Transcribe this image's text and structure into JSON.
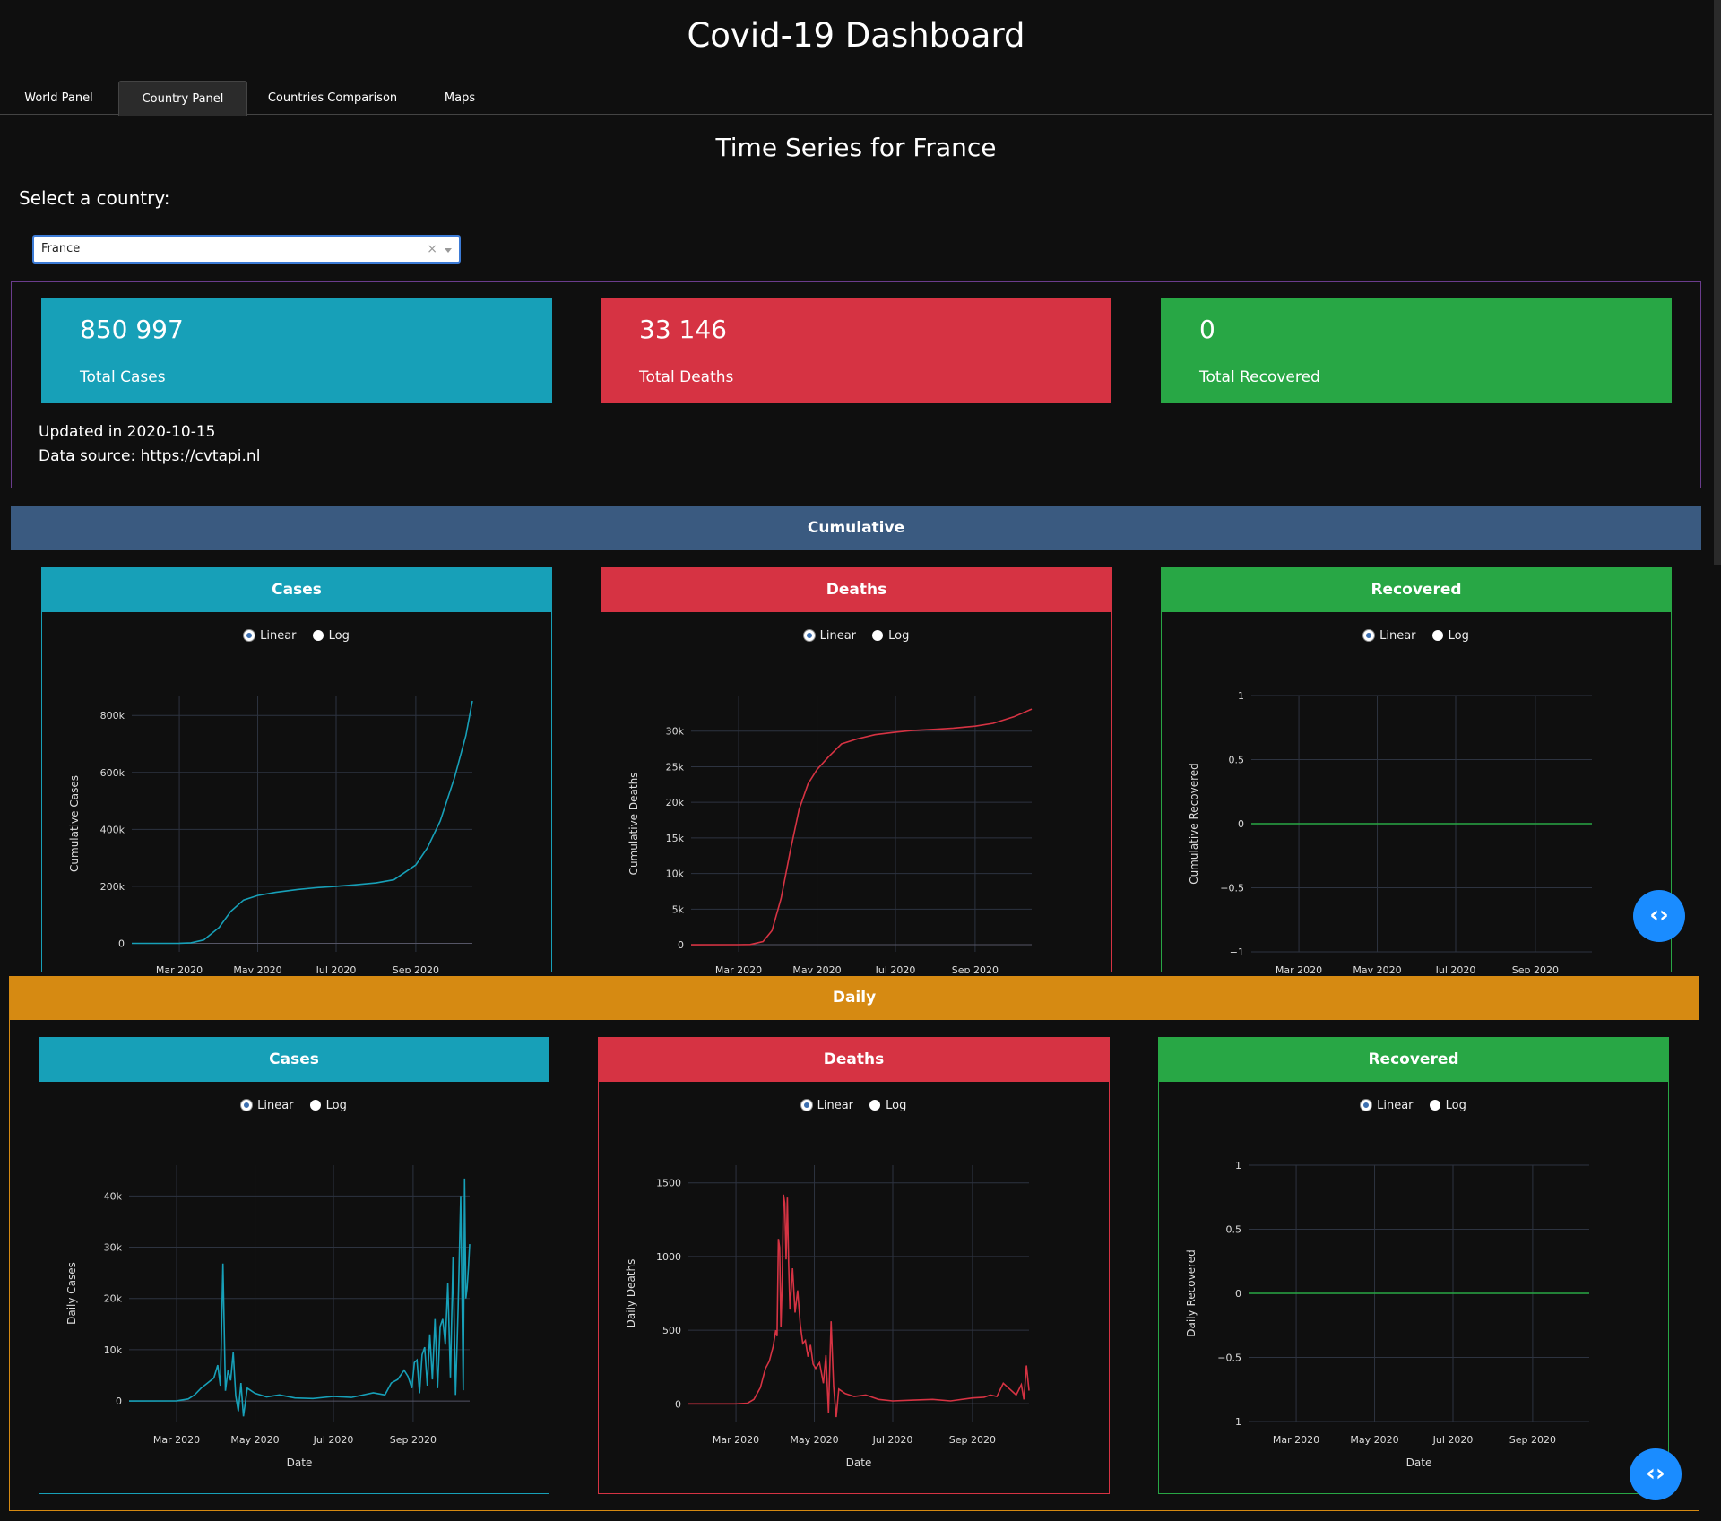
{
  "app": {
    "title": "Covid-19 Dashboard"
  },
  "tabs": [
    {
      "label": "World Panel"
    },
    {
      "label": "Country Panel",
      "active": true
    },
    {
      "label": "Countries Comparison"
    },
    {
      "label": "Maps"
    }
  ],
  "page": {
    "heading": "Time Series for France"
  },
  "selector": {
    "label": "Select a country:",
    "value": "France",
    "clear": "×"
  },
  "summary": {
    "cases": {
      "value": "850 997",
      "label": "Total Cases",
      "color": "#17a0b8"
    },
    "deaths": {
      "value": "33 146",
      "label": "Total Deaths",
      "color": "#d63343"
    },
    "recovered": {
      "value": "0",
      "label": "Total Recovered",
      "color": "#28a745"
    },
    "updated": "Updated in 2020-10-15",
    "source": "Data source: https://cvtapi.nl"
  },
  "sections": {
    "cumulative": "Cumulative",
    "daily": "Daily"
  },
  "panels": {
    "cases": "Cases",
    "deaths": "Deaths",
    "recovered": "Recovered",
    "linear": "Linear",
    "log": "Log"
  },
  "fab": {
    "icon": "code-brackets-icon"
  },
  "chart_data": [
    {
      "type": "line",
      "id": "cum-cases",
      "color": "#17a0b8",
      "ylabel": "Cumulative Cases",
      "xlabel": "",
      "xticks": [
        "Mar 2020",
        "May 2020",
        "Jul 2020",
        "Sep 2020"
      ],
      "yticks": [
        "0",
        "200k",
        "400k",
        "600k",
        "800k"
      ],
      "ylim": [
        -30000,
        870000
      ],
      "x": [
        "2020-01-24",
        "2020-03-01",
        "2020-03-10",
        "2020-03-20",
        "2020-04-01",
        "2020-04-10",
        "2020-04-20",
        "2020-05-01",
        "2020-05-15",
        "2020-06-01",
        "2020-06-15",
        "2020-07-01",
        "2020-07-15",
        "2020-08-01",
        "2020-08-15",
        "2020-09-01",
        "2020-09-10",
        "2020-09-20",
        "2020-10-01",
        "2020-10-10",
        "2020-10-15"
      ],
      "values": [
        0,
        130,
        1800,
        12000,
        56000,
        112000,
        152000,
        168000,
        179000,
        189000,
        195000,
        200000,
        205000,
        212000,
        223000,
        275000,
        335000,
        430000,
        580000,
        730000,
        851000
      ]
    },
    {
      "type": "line",
      "id": "cum-deaths",
      "color": "#d63343",
      "ylabel": "Cumulative Deaths",
      "xlabel": "",
      "xticks": [
        "Mar 2020",
        "May 2020",
        "Jul 2020",
        "Sep 2020"
      ],
      "yticks": [
        "0",
        "5k",
        "10k",
        "15k",
        "20k",
        "25k",
        "30k"
      ],
      "ylim": [
        -1000,
        35000
      ],
      "x": [
        "2020-01-24",
        "2020-03-01",
        "2020-03-10",
        "2020-03-20",
        "2020-03-27",
        "2020-04-03",
        "2020-04-10",
        "2020-04-17",
        "2020-04-24",
        "2020-05-01",
        "2020-05-10",
        "2020-05-20",
        "2020-06-01",
        "2020-06-15",
        "2020-07-01",
        "2020-07-15",
        "2020-08-01",
        "2020-08-15",
        "2020-09-01",
        "2020-09-15",
        "2020-10-01",
        "2020-10-15"
      ],
      "values": [
        0,
        2,
        33,
        450,
        2000,
        6500,
        13000,
        19000,
        22600,
        24600,
        26400,
        28200,
        28900,
        29500,
        29850,
        30100,
        30250,
        30420,
        30700,
        31100,
        32000,
        33100
      ]
    },
    {
      "type": "line",
      "id": "cum-recovered",
      "color": "#28a745",
      "ylabel": "Cumulative Recovered",
      "xlabel": "",
      "xticks": [
        "Mar 2020",
        "May 2020",
        "Jul 2020",
        "Sep 2020"
      ],
      "yticks": [
        "−1",
        "−0.5",
        "0",
        "0.5",
        "1"
      ],
      "ylim": [
        -1,
        1
      ],
      "x": [
        "2020-01-24",
        "2020-10-15"
      ],
      "values": [
        0,
        0
      ]
    },
    {
      "type": "line",
      "id": "daily-cases",
      "color": "#17a0b8",
      "ylabel": "Daily Cases",
      "xlabel": "Date",
      "xticks": [
        "Mar 2020",
        "May 2020",
        "Jul 2020",
        "Sep 2020"
      ],
      "yticks": [
        "0",
        "10k",
        "20k",
        "30k",
        "40k"
      ],
      "ylim": [
        -4000,
        46000
      ],
      "x": [
        "2020-01-24",
        "2020-03-01",
        "2020-03-10",
        "2020-03-15",
        "2020-03-20",
        "2020-03-25",
        "2020-03-30",
        "2020-04-02",
        "2020-04-04",
        "2020-04-06",
        "2020-04-08",
        "2020-04-10",
        "2020-04-12",
        "2020-04-14",
        "2020-04-16",
        "2020-04-18",
        "2020-04-20",
        "2020-04-22",
        "2020-04-25",
        "2020-05-01",
        "2020-05-10",
        "2020-05-20",
        "2020-06-01",
        "2020-06-15",
        "2020-07-01",
        "2020-07-15",
        "2020-08-01",
        "2020-08-10",
        "2020-08-15",
        "2020-08-20",
        "2020-08-25",
        "2020-08-28",
        "2020-08-31",
        "2020-09-02",
        "2020-09-04",
        "2020-09-06",
        "2020-09-08",
        "2020-09-10",
        "2020-09-12",
        "2020-09-14",
        "2020-09-16",
        "2020-09-18",
        "2020-09-20",
        "2020-09-22",
        "2020-09-24",
        "2020-09-26",
        "2020-09-28",
        "2020-09-30",
        "2020-10-02",
        "2020-10-04",
        "2020-10-06",
        "2020-10-08",
        "2020-10-10",
        "2020-10-11",
        "2020-10-12",
        "2020-10-13",
        "2020-10-14",
        "2020-10-15"
      ],
      "values": [
        0,
        40,
        400,
        1200,
        2500,
        3500,
        4500,
        7000,
        3000,
        26800,
        2000,
        6000,
        4000,
        9500,
        1000,
        -2000,
        3500,
        -3000,
        2500,
        1500,
        800,
        1200,
        600,
        500,
        900,
        700,
        1600,
        1200,
        3500,
        4200,
        6000,
        4800,
        2500,
        7500,
        8000,
        1500,
        9000,
        10500,
        3000,
        13000,
        4200,
        16000,
        2500,
        14500,
        16000,
        11000,
        23000,
        4600,
        28000,
        1200,
        18000,
        40000,
        2100,
        43400,
        20000,
        22000,
        26000,
        30600
      ]
    },
    {
      "type": "line",
      "id": "daily-deaths",
      "color": "#d63343",
      "ylabel": "Daily Deaths",
      "xlabel": "Date",
      "xticks": [
        "Mar 2020",
        "May 2020",
        "Jul 2020",
        "Sep 2020"
      ],
      "yticks": [
        "0",
        "500",
        "1000",
        "1500"
      ],
      "ylim": [
        -120,
        1620
      ],
      "x": [
        "2020-01-24",
        "2020-03-01",
        "2020-03-10",
        "2020-03-15",
        "2020-03-20",
        "2020-03-24",
        "2020-03-27",
        "2020-03-30",
        "2020-04-01",
        "2020-04-02",
        "2020-04-03",
        "2020-04-04",
        "2020-04-05",
        "2020-04-06",
        "2020-04-07",
        "2020-04-08",
        "2020-04-09",
        "2020-04-10",
        "2020-04-11",
        "2020-04-12",
        "2020-04-14",
        "2020-04-16",
        "2020-04-18",
        "2020-04-20",
        "2020-04-22",
        "2020-04-24",
        "2020-04-26",
        "2020-04-28",
        "2020-04-30",
        "2020-05-02",
        "2020-05-05",
        "2020-05-08",
        "2020-05-10",
        "2020-05-12",
        "2020-05-14",
        "2020-05-16",
        "2020-05-18",
        "2020-05-20",
        "2020-05-25",
        "2020-06-01",
        "2020-06-10",
        "2020-06-20",
        "2020-07-01",
        "2020-07-15",
        "2020-08-01",
        "2020-08-15",
        "2020-09-01",
        "2020-09-10",
        "2020-09-15",
        "2020-09-20",
        "2020-09-25",
        "2020-09-30",
        "2020-10-05",
        "2020-10-09",
        "2020-10-11",
        "2020-10-13",
        "2020-10-15"
      ],
      "values": [
        0,
        0,
        5,
        30,
        110,
        240,
        290,
        390,
        500,
        460,
        1120,
        1060,
        520,
        840,
        1420,
        1360,
        980,
        1400,
        960,
        640,
        920,
        620,
        770,
        540,
        410,
        430,
        320,
        400,
        270,
        240,
        280,
        140,
        330,
        -60,
        560,
        120,
        -90,
        100,
        70,
        50,
        60,
        30,
        20,
        25,
        30,
        20,
        40,
        45,
        60,
        50,
        140,
        100,
        60,
        130,
        30,
        260,
        90
      ]
    },
    {
      "type": "line",
      "id": "daily-recovered",
      "color": "#28a745",
      "ylabel": "Daily Recovered",
      "xlabel": "Date",
      "xticks": [
        "Mar 2020",
        "May 2020",
        "Jul 2020",
        "Sep 2020"
      ],
      "yticks": [
        "−1",
        "−0.5",
        "0",
        "0.5",
        "1"
      ],
      "ylim": [
        -1,
        1
      ],
      "x": [
        "2020-01-24",
        "2020-10-15"
      ],
      "values": [
        0,
        0
      ]
    }
  ]
}
